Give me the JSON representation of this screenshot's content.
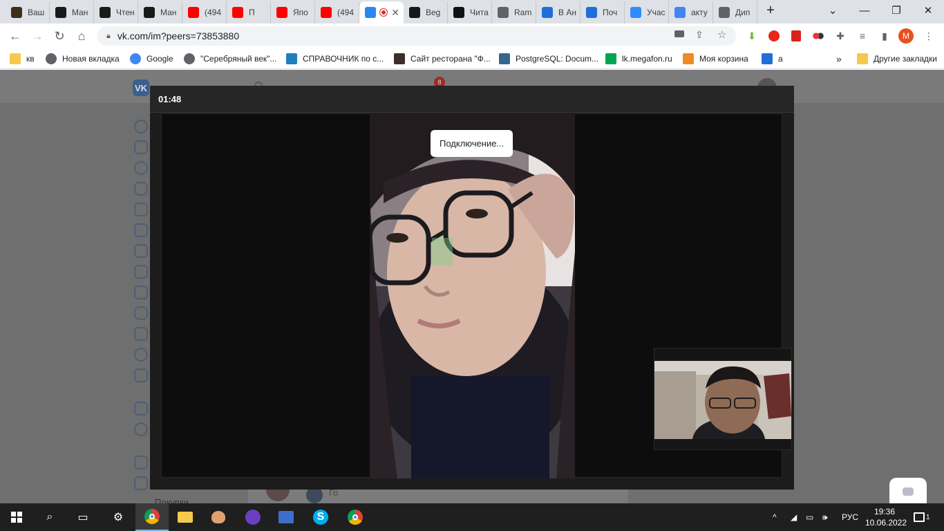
{
  "browser": {
    "tabs": [
      {
        "label": "Ваш",
        "icon": "goodreads-icon",
        "color": "#3f2f1a"
      },
      {
        "label": "Ман",
        "icon": "manga-icon",
        "color": "#1a1a1a"
      },
      {
        "label": "Чтен",
        "icon": "manga-icon",
        "color": "#1a1a1a"
      },
      {
        "label": "Ман",
        "icon": "manga-icon",
        "color": "#1a1a1a"
      },
      {
        "label": "(494",
        "icon": "youtube-icon",
        "color": "#ff0000"
      },
      {
        "label": "П",
        "icon": "youtube-icon",
        "color": "#ff0000"
      },
      {
        "label": "Япо",
        "icon": "youtube-icon",
        "color": "#ff0000"
      },
      {
        "label": "(494",
        "icon": "youtube-icon",
        "color": "#ff0000"
      },
      {
        "label": "",
        "icon": "vk-messenger-icon",
        "color": "#2787f5"
      },
      {
        "label": "Beg",
        "icon": "github-icon",
        "color": "#181717"
      },
      {
        "label": "Чита",
        "icon": "yin-yang-icon",
        "color": "#111111"
      },
      {
        "label": "Ram",
        "icon": "globe-icon",
        "color": "#5f6368"
      },
      {
        "label": "В Ан",
        "icon": "mail-at-icon",
        "color": "#1e6fd9"
      },
      {
        "label": "Поч",
        "icon": "mail-icon",
        "color": "#1e6fd9"
      },
      {
        "label": "Учас",
        "icon": "zoom-icon",
        "color": "#2d8cff"
      },
      {
        "label": "акту",
        "icon": "google-icon",
        "color": "#4285f4"
      },
      {
        "label": "Дип",
        "icon": "globe-icon",
        "color": "#5f6368"
      }
    ],
    "new_tab": "+",
    "url": "vk.com/im?peers=73853880",
    "profile_initial": "M"
  },
  "bookmarks": [
    {
      "label": "кв",
      "icon": "folder-icon"
    },
    {
      "label": "Новая вкладка",
      "icon": "globe-icon"
    },
    {
      "label": "Google",
      "icon": "google-icon"
    },
    {
      "label": "\"Серебряный век\"...",
      "icon": "globe-icon"
    },
    {
      "label": "СПРАВОЧНИК по с...",
      "icon": "book-icon"
    },
    {
      "label": "Сайт ресторана \"Ф...",
      "icon": "restaurant-icon"
    },
    {
      "label": "PostgreSQL: Docum...",
      "icon": "postgres-icon"
    },
    {
      "label": "lk.megafon.ru",
      "icon": "megafon-icon"
    },
    {
      "label": "Моя корзина",
      "icon": "cart-icon"
    },
    {
      "label": "a",
      "icon": "mail-icon"
    }
  ],
  "bookmarks_more": "»",
  "other_bookmarks": "Другие закладки",
  "vk": {
    "notification_count": "8",
    "menu_label_partial": "Покупки",
    "conv_preview": "Го"
  },
  "call": {
    "timer": "01:48",
    "status": "Подключение..."
  },
  "taskbar": {
    "language": "РУС",
    "time": "19:36",
    "date": "10.06.2022",
    "notif_count": "1"
  }
}
